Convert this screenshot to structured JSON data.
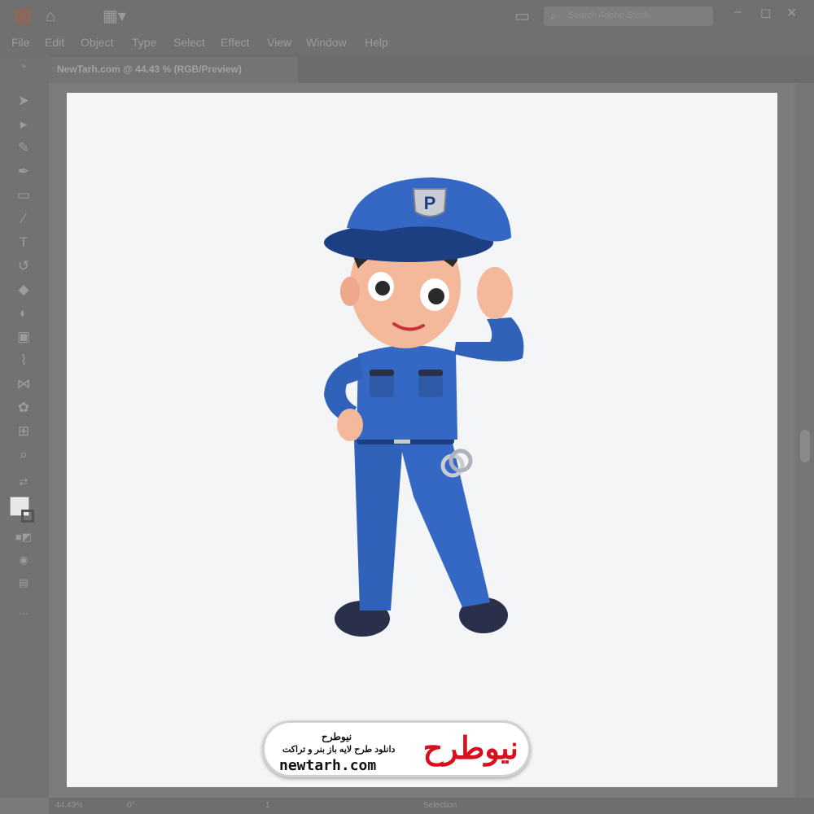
{
  "menu": [
    "File",
    "Edit",
    "Object",
    "Type",
    "Select",
    "Effect",
    "View",
    "Window",
    "Help"
  ],
  "document_tab": "NewTarh.com @ 44.43 % (RGB/Preview)",
  "search_placeholder": "Search Adobe Stock",
  "status": {
    "zoom": "44.43%",
    "rotation": "0°",
    "artboard": "1",
    "tool": "Selection"
  },
  "watermark": {
    "title": "نیوطرح",
    "subtitle": "دانلود طرح لایه باز بنر و تراکت",
    "url": "newtarh.com",
    "logo_text": "نیوطرح",
    "logo_color": "#d8101e"
  },
  "cap_badge": "P",
  "colors": {
    "uniform": "#2f62b8",
    "uniform_dark": "#1c3f82",
    "shoe": "#2a2f4a",
    "skin": "#f4b89a"
  },
  "icons": [
    "home-icon",
    "workspace-icon",
    "arrange-icon",
    "search-icon",
    "minimize-icon",
    "maximize-icon",
    "close-icon"
  ]
}
